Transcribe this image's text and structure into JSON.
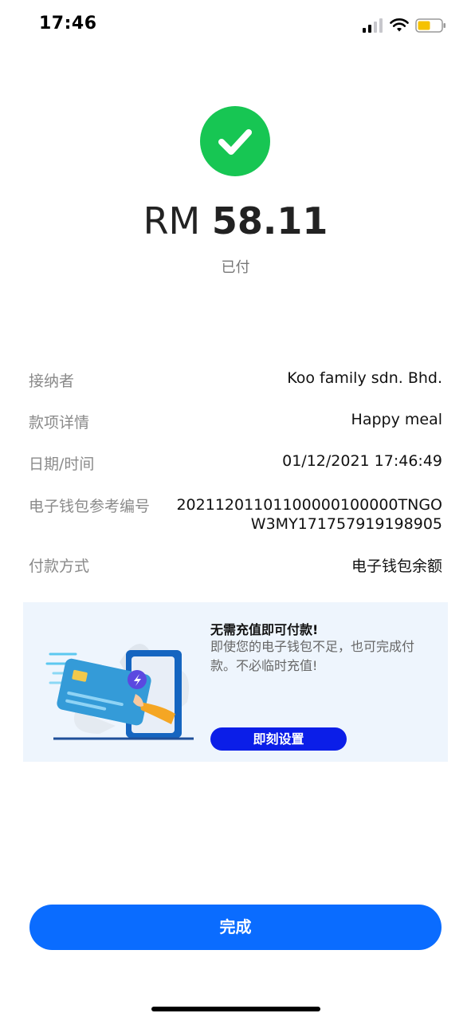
{
  "status_bar": {
    "time": "17:46"
  },
  "payment": {
    "currency": "RM",
    "amount": "58.11",
    "status": "已付"
  },
  "details": {
    "receiver_label": "接纳者",
    "receiver_value": "Koo family sdn. Bhd.",
    "item_label": "款项详情",
    "item_value": "Happy meal",
    "datetime_label": "日期/时间",
    "datetime_value": "01/12/2021 17:46:49",
    "ref_label": "电子钱包参考编号",
    "ref_value": "20211201101100000100000TNGOW3MY171757919198905",
    "method_label": "付款方式",
    "method_value": "电子钱包余额"
  },
  "promo": {
    "title": "无需充值即可付款!",
    "description": "即使您的电子钱包不足，也可完成付款。不必临时充值!",
    "button_label": "即刻设置"
  },
  "footer": {
    "done_label": "完成"
  },
  "colors": {
    "success_green": "#17c653",
    "primary_blue": "#0a6cff",
    "promo_button_blue": "#0b1ee8",
    "promo_bg": "#eef5fd"
  }
}
